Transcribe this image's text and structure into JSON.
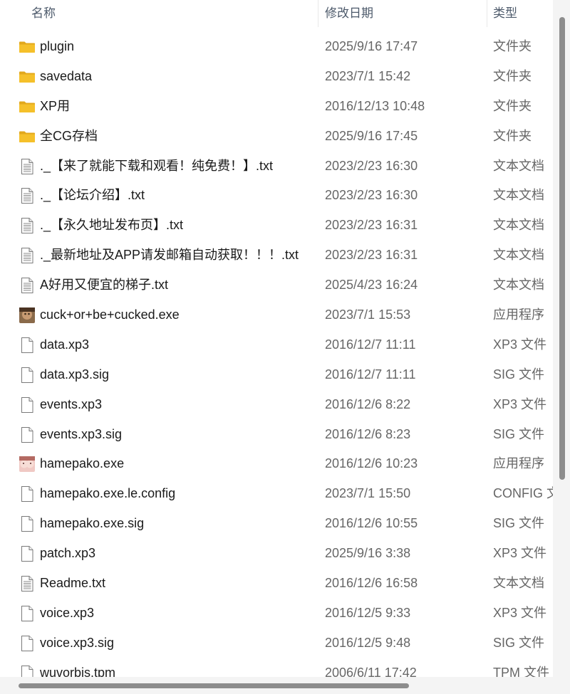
{
  "header": {
    "name": "名称",
    "date": "修改日期",
    "type": "类型"
  },
  "files": [
    {
      "name": "plugin",
      "date": "2025/9/16 17:47",
      "type": "文件夹",
      "icon": "folder-icon"
    },
    {
      "name": "savedata",
      "date": "2023/7/1 15:42",
      "type": "文件夹",
      "icon": "folder-icon"
    },
    {
      "name": "XP用",
      "date": "2016/12/13 10:48",
      "type": "文件夹",
      "icon": "folder-icon"
    },
    {
      "name": "全CG存档",
      "date": "2025/9/16 17:45",
      "type": "文件夹",
      "icon": "folder-icon"
    },
    {
      "name": "._【来了就能下载和观看！纯免费！】.txt",
      "date": "2023/2/23 16:30",
      "type": "文本文档",
      "icon": "text-file-icon"
    },
    {
      "name": "._【论坛介绍】.txt",
      "date": "2023/2/23 16:30",
      "type": "文本文档",
      "icon": "text-file-icon"
    },
    {
      "name": "._【永久地址发布页】.txt",
      "date": "2023/2/23 16:31",
      "type": "文本文档",
      "icon": "text-file-icon"
    },
    {
      "name": "._最新地址及APP请发邮箱自动获取！！！.txt",
      "date": "2023/2/23 16:31",
      "type": "文本文档",
      "icon": "text-file-icon"
    },
    {
      "name": "A好用又便宜的梯子.txt",
      "date": "2025/4/23 16:24",
      "type": "文本文档",
      "icon": "text-file-icon"
    },
    {
      "name": "cuck+or+be+cucked.exe",
      "date": "2023/7/1 15:53",
      "type": "应用程序",
      "icon": "app-exe-icon"
    },
    {
      "name": "data.xp3",
      "date": "2016/12/7 11:11",
      "type": "XP3 文件",
      "icon": "blank-file-icon"
    },
    {
      "name": "data.xp3.sig",
      "date": "2016/12/7 11:11",
      "type": "SIG 文件",
      "icon": "blank-file-icon"
    },
    {
      "name": "events.xp3",
      "date": "2016/12/6 8:22",
      "type": "XP3 文件",
      "icon": "blank-file-icon"
    },
    {
      "name": "events.xp3.sig",
      "date": "2016/12/6 8:23",
      "type": "SIG 文件",
      "icon": "blank-file-icon"
    },
    {
      "name": "hamepako.exe",
      "date": "2016/12/6 10:23",
      "type": "应用程序",
      "icon": "app-exe-icon-2"
    },
    {
      "name": "hamepako.exe.le.config",
      "date": "2023/7/1 15:50",
      "type": "CONFIG 文件",
      "icon": "blank-file-icon"
    },
    {
      "name": "hamepako.exe.sig",
      "date": "2016/12/6 10:55",
      "type": "SIG 文件",
      "icon": "blank-file-icon"
    },
    {
      "name": "patch.xp3",
      "date": "2025/9/16 3:38",
      "type": "XP3 文件",
      "icon": "blank-file-icon"
    },
    {
      "name": "Readme.txt",
      "date": "2016/12/6 16:58",
      "type": "文本文档",
      "icon": "text-file-icon"
    },
    {
      "name": "voice.xp3",
      "date": "2016/12/5 9:33",
      "type": "XP3 文件",
      "icon": "blank-file-icon"
    },
    {
      "name": "voice.xp3.sig",
      "date": "2016/12/5 9:48",
      "type": "SIG 文件",
      "icon": "blank-file-icon"
    },
    {
      "name": "wuvorbis.tpm",
      "date": "2006/6/11 17:42",
      "type": "TPM 文件",
      "icon": "blank-file-icon"
    }
  ],
  "colors": {
    "folder": "#f5c02a",
    "folder_dark": "#e2a81c",
    "header_text": "#4d5a6b",
    "secondary_text": "#666666"
  }
}
